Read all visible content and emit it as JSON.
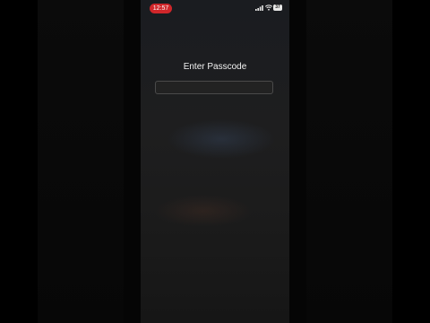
{
  "status_bar": {
    "time": "12:57",
    "time_pill_color": "#d0262a",
    "signal_icon": "cellular-signal-icon",
    "wifi_icon": "wifi-icon",
    "battery_level": "37"
  },
  "lock_screen": {
    "title": "Enter Passcode",
    "passcode_value": ""
  }
}
